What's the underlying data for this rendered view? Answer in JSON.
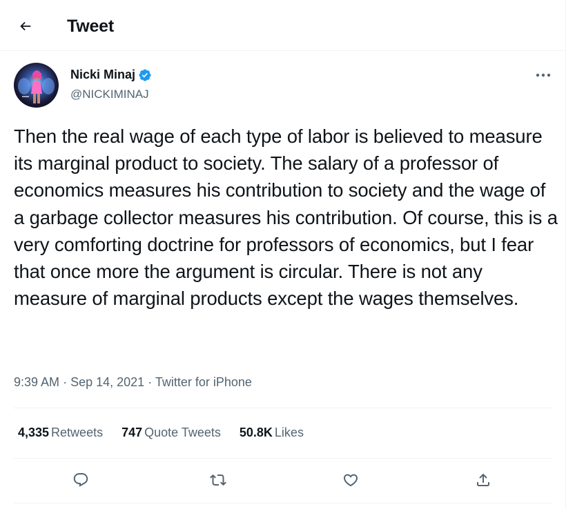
{
  "header": {
    "title": "Tweet"
  },
  "author": {
    "name": "Nicki Minaj",
    "handle": "@NICKIMINAJ"
  },
  "tweet": {
    "text": "Then the real wage of each type of labor is believed to measure its marginal product to society. The salary of a professor of economics measures his contribution to society and the wage of a garbage collector measures his contribution. Of course, this is a very comforting doctrine for professors of economics, but I fear that once more the argument is circular. There is not any measure of marginal products except the wages themselves.",
    "time": "9:39 AM",
    "date": "Sep 14, 2021",
    "source": "Twitter for iPhone",
    "separator": "·"
  },
  "stats": {
    "retweets_count": "4,335",
    "retweets_label": "Retweets",
    "quotes_count": "747",
    "quotes_label": "Quote Tweets",
    "likes_count": "50.8K",
    "likes_label": "Likes"
  },
  "icons": {
    "back": "arrow-left-icon",
    "verified": "verified-badge-icon",
    "more": "more-options-icon",
    "reply": "reply-icon",
    "retweet": "retweet-icon",
    "like": "like-icon",
    "share": "share-icon"
  },
  "colors": {
    "text": "#0f1419",
    "secondary": "#536471",
    "verified": "#1d9bf0",
    "divider": "#eff3f4"
  }
}
